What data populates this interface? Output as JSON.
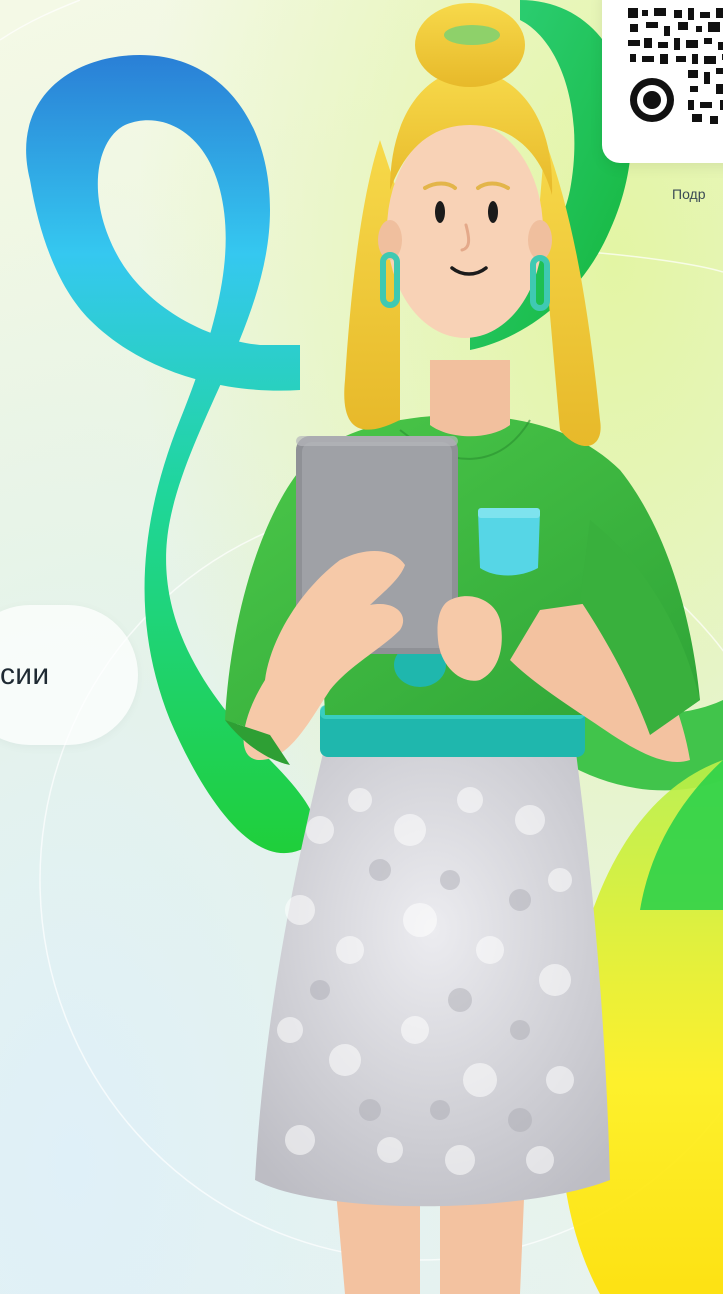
{
  "qr": {
    "caption": "Подр"
  },
  "pill": {
    "text": "сии"
  },
  "colors": {
    "ribbon_green": "#1fcf3a",
    "ribbon_cyan": "#35c8f0",
    "ribbon_blue": "#2a7fd6",
    "hair_yellow": "#f2cf3a",
    "sweater_green": "#3dbb3d",
    "pocket_cyan": "#56d6e6",
    "skirt_silver": "#d9d9de",
    "tablet_gray": "#8f9196",
    "skin": "#f6c9a8",
    "accent_yellow": "#ffe714"
  },
  "icons": {
    "qr": "qr-code-icon",
    "character": "woman-with-tablet-illustration"
  }
}
